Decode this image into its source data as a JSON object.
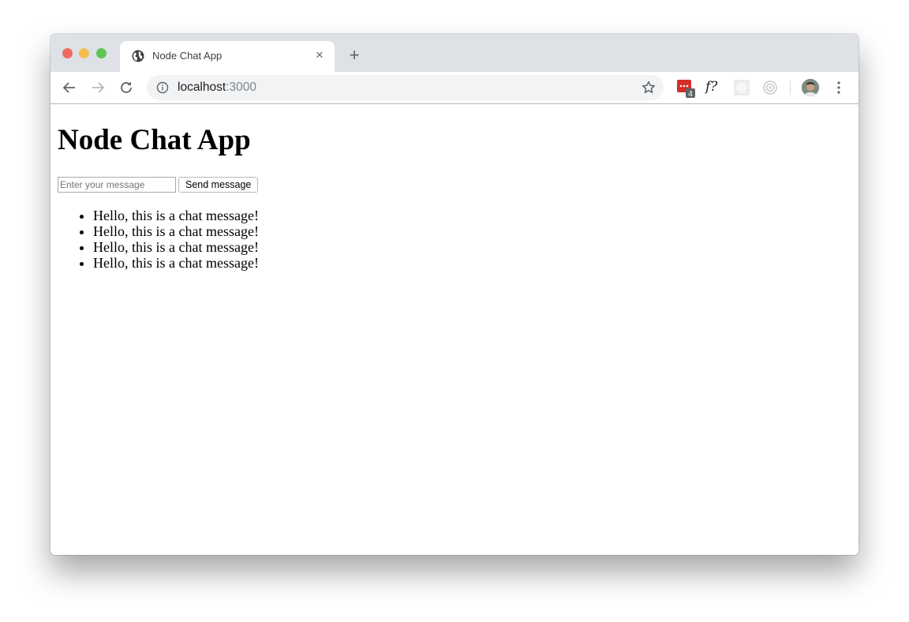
{
  "browser": {
    "tab": {
      "title": "Node Chat App",
      "favicon": "globe-icon",
      "close": "×"
    },
    "new_tab": "+",
    "url": {
      "host": "localhost",
      "port": ":3000"
    },
    "extensions": [
      {
        "name": "lastpass-icon",
        "badge": "4",
        "color": "#d32d27"
      },
      {
        "name": "font-detector-icon",
        "label": "f?"
      },
      {
        "name": "react-devtools-icon"
      },
      {
        "name": "target-icon"
      }
    ]
  },
  "page": {
    "heading": "Node Chat App",
    "input": {
      "placeholder": "Enter your message",
      "value": ""
    },
    "send_button": "Send message",
    "messages": [
      "Hello, this is a chat message!",
      "Hello, this is a chat message!",
      "Hello, this is a chat message!",
      "Hello, this is a chat message!"
    ]
  }
}
